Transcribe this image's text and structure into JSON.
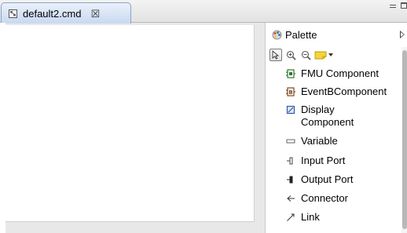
{
  "editor": {
    "tab_title": "default2.cmd",
    "tab_close": "☒"
  },
  "palette": {
    "title": "Palette",
    "items": [
      {
        "label": "FMU Component",
        "icon": "fmu-component-icon"
      },
      {
        "label": "EventBComponent",
        "icon": "eventb-component-icon"
      },
      {
        "label": "Display Component",
        "icon": "display-component-icon"
      },
      {
        "label": "Variable",
        "icon": "variable-icon"
      },
      {
        "label": "Input Port",
        "icon": "input-port-icon"
      },
      {
        "label": "Output Port",
        "icon": "output-port-icon"
      },
      {
        "label": "Connector",
        "icon": "connector-icon"
      },
      {
        "label": "Link",
        "icon": "link-icon"
      }
    ]
  },
  "colors": {
    "tab_active": "#c8d9f0",
    "tab_border": "#8aa2c4",
    "accent_green": "#2f7a2f",
    "accent_blue": "#2f5aa8"
  }
}
